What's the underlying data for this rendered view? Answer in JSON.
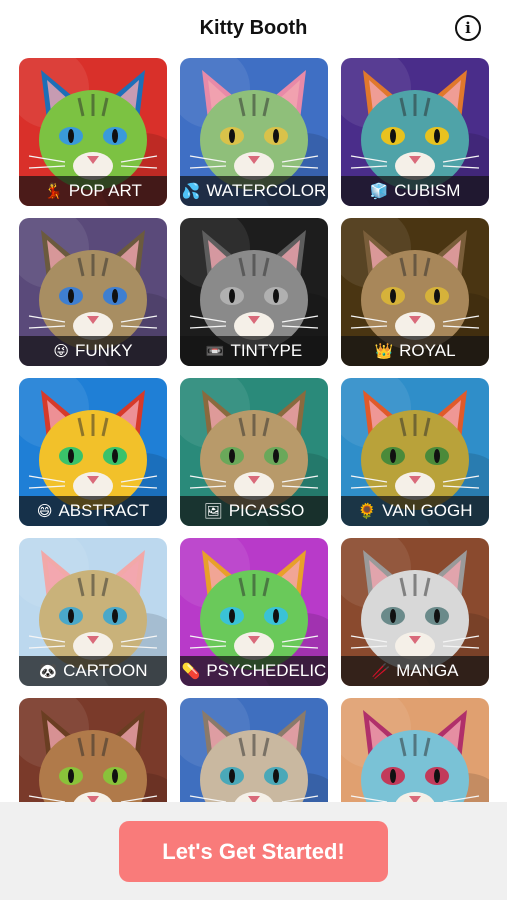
{
  "app": {
    "title": "Kitty Booth"
  },
  "header": {
    "info_icon": "info-icon"
  },
  "styles": [
    {
      "id": "pop-art",
      "label": "POP ART",
      "icon": "💃",
      "palette": {
        "bg": "#d9302a",
        "fur": "#7cc242",
        "ear": "#1d6fb8",
        "eye": "#3a9ad9"
      }
    },
    {
      "id": "watercolor",
      "label": "WATERCOLOR",
      "icon": "💦",
      "palette": {
        "bg": "#3f6fc4",
        "fur": "#8fbf7a",
        "ear": "#e88aa8",
        "eye": "#d9c24a"
      }
    },
    {
      "id": "cubism",
      "label": "CUBISM",
      "icon": "🧊",
      "palette": {
        "bg": "#4a2d8a",
        "fur": "#4fa3a8",
        "ear": "#e0782c",
        "eye": "#e8c21f"
      }
    },
    {
      "id": "funky",
      "label": "FUNKY",
      "icon": "😜",
      "palette": {
        "bg": "#5a4a7a",
        "fur": "#a88e62",
        "ear": "#6b5a3e",
        "eye": "#3f7fd0"
      }
    },
    {
      "id": "tintype",
      "label": "TINTYPE",
      "icon": "📼",
      "palette": {
        "bg": "#1d1d1d",
        "fur": "#8a8a8a",
        "ear": "#5e5e5e",
        "eye": "#b0b0b0"
      }
    },
    {
      "id": "royal",
      "label": "ROYAL",
      "icon": "👑",
      "palette": {
        "bg": "#4a3512",
        "fur": "#a8875a",
        "ear": "#7a5e3a",
        "eye": "#d6b23a"
      }
    },
    {
      "id": "abstract",
      "label": "ABSTRACT",
      "icon": "😄",
      "palette": {
        "bg": "#1f7fd6",
        "fur": "#f2c12a",
        "ear": "#d63a2a",
        "eye": "#3ac26a"
      }
    },
    {
      "id": "picasso",
      "label": "PICASSO",
      "icon": "🖼",
      "palette": {
        "bg": "#2a8a7a",
        "fur": "#b89a6a",
        "ear": "#8a6a3e",
        "eye": "#6aa85a"
      }
    },
    {
      "id": "van-gogh",
      "label": "VAN GOGH",
      "icon": "🌻",
      "palette": {
        "bg": "#2f8ec9",
        "fur": "#b9a23a",
        "ear": "#e05a2a",
        "eye": "#4a8a3a"
      }
    },
    {
      "id": "cartoon",
      "label": "CARTOON",
      "icon": "🐼",
      "palette": {
        "bg": "#bcd8ee",
        "fur": "#c9b27a",
        "ear": "#f2a8a8",
        "eye": "#4aa8c9"
      }
    },
    {
      "id": "psychedelic",
      "label": "PSYCHEDELIC",
      "icon": "💊",
      "palette": {
        "bg": "#b83ac9",
        "fur": "#6ac95a",
        "ear": "#e8a02a",
        "eye": "#3ac2d6"
      }
    },
    {
      "id": "manga",
      "label": "MANGA",
      "icon": "🥢",
      "palette": {
        "bg": "#8a4a2e",
        "fur": "#d8d8d8",
        "ear": "#9a9a9a",
        "eye": "#6a8a8a"
      }
    },
    {
      "id": "style-13",
      "label": "",
      "icon": "",
      "palette": {
        "bg": "#7a3a2a",
        "fur": "#b07a4a",
        "ear": "#6a3e22",
        "eye": "#8ac23a"
      }
    },
    {
      "id": "style-14",
      "label": "",
      "icon": "",
      "palette": {
        "bg": "#3f6fbf",
        "fur": "#c9b8a0",
        "ear": "#8a7a6a",
        "eye": "#4aa8b8"
      }
    },
    {
      "id": "style-15",
      "label": "",
      "icon": "",
      "palette": {
        "bg": "#e0a070",
        "fur": "#7ac2d6",
        "ear": "#b0306a",
        "eye": "#c23a5a"
      }
    }
  ],
  "footer": {
    "cta_label": "Let's Get Started!"
  }
}
